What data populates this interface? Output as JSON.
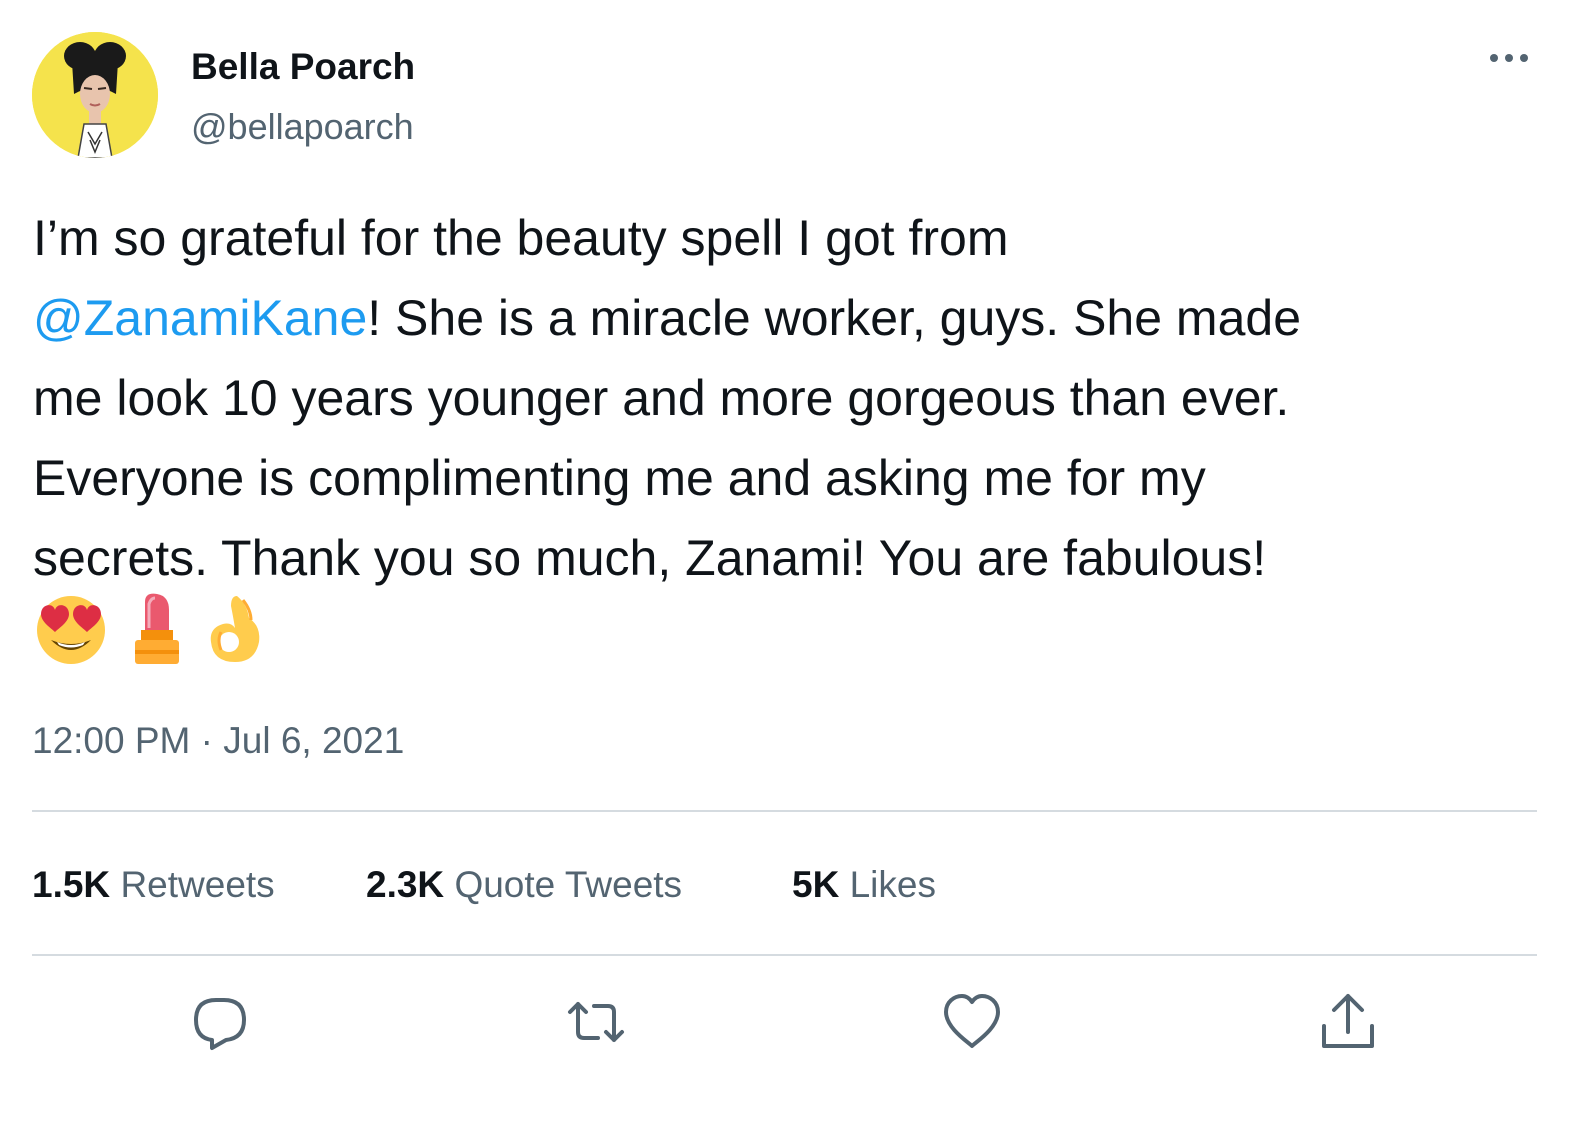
{
  "author": {
    "name": "Bella Poarch",
    "handle": "@bellapoarch"
  },
  "tweet": {
    "line1": "I’m so grateful for the beauty spell I got from",
    "mention": "@ZanamiKane",
    "line2_rest": "! She is a miracle worker, guys. She made",
    "line3": "me look 10 years younger and more gorgeous than ever.",
    "line4": "Everyone is complimenting me and asking me for my",
    "line5": "secrets. Thank you so much, Zanami! You are fabulous!",
    "emojis": [
      "heart-eyes-emoji",
      "lipstick-emoji",
      "ok-hand-emoji"
    ],
    "timestamp": "12:00 PM · Jul 6, 2021"
  },
  "stats": {
    "retweets_count": "1.5K",
    "retweets_label": "Retweets",
    "quotes_count": "2.3K",
    "quotes_label": "Quote Tweets",
    "likes_count": "5K",
    "likes_label": "Likes"
  },
  "actions": [
    "reply-icon",
    "retweet-icon",
    "like-icon",
    "share-icon"
  ],
  "colors": {
    "text": "#0f1419",
    "secondary": "#536471",
    "link": "#1d9bf0",
    "divider": "#d5dbe0",
    "avatar_bg": "#f5e34c"
  }
}
